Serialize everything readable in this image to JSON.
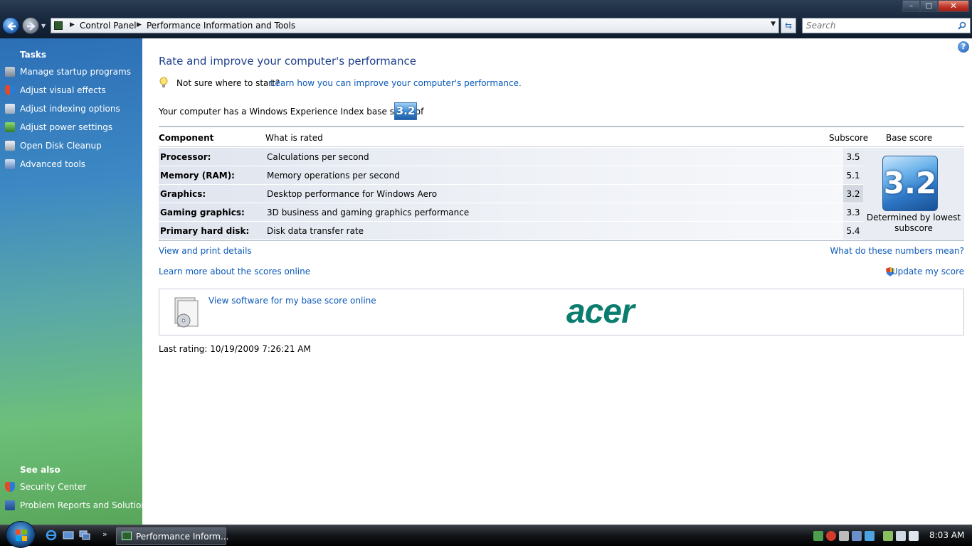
{
  "window": {
    "breadcrumbs": [
      "Control Panel",
      "Performance Information and Tools"
    ],
    "search_placeholder": "Search",
    "controls": {
      "minimize": "–",
      "maximize": "□",
      "close": "✕"
    }
  },
  "sidebar": {
    "tasks_heading": "Tasks",
    "tasks": [
      {
        "label": "Manage startup programs",
        "icon": "startup-programs-icon"
      },
      {
        "label": "Adjust visual effects",
        "icon": "shield-icon"
      },
      {
        "label": "Adjust indexing options",
        "icon": "indexing-icon"
      },
      {
        "label": "Adjust power settings",
        "icon": "power-icon"
      },
      {
        "label": "Open Disk Cleanup",
        "icon": "disk-cleanup-icon"
      },
      {
        "label": "Advanced tools",
        "icon": "advanced-tools-icon"
      }
    ],
    "see_also_heading": "See also",
    "see_also": [
      {
        "label": "Security Center",
        "icon": "security-center-icon"
      },
      {
        "label": "Problem Reports and Solutions",
        "icon": "problem-reports-icon"
      }
    ]
  },
  "main": {
    "title": "Rate and improve your computer's performance",
    "tip_prefix": "Not sure where to start?",
    "tip_link": "Learn how you can improve your computer's performance.",
    "base_score_sentence": "Your computer has a Windows Experience Index base score of",
    "base_score": "3.2",
    "table": {
      "headers": {
        "component": "Component",
        "what": "What is rated",
        "subscore": "Subscore",
        "base": "Base score"
      },
      "rows": [
        {
          "component": "Processor:",
          "what": "Calculations per second",
          "subscore": "3.5"
        },
        {
          "component": "Memory (RAM):",
          "what": "Memory operations per second",
          "subscore": "5.1"
        },
        {
          "component": "Graphics:",
          "what": "Desktop performance for Windows Aero",
          "subscore": "3.2"
        },
        {
          "component": "Gaming graphics:",
          "what": "3D business and gaming graphics performance",
          "subscore": "3.3"
        },
        {
          "component": "Primary hard disk:",
          "what": "Disk data transfer rate",
          "subscore": "5.4"
        }
      ],
      "base_caption": "Determined by lowest subscore"
    },
    "links": {
      "view_print": "View and print details",
      "what_mean": "What do these numbers mean?",
      "learn_online": "Learn more about the scores online",
      "update_score": "Update my score"
    },
    "oem": {
      "link": "View software for my base score online",
      "logo": "acer"
    },
    "last_rating": "Last rating: 10/19/2009 7:26:21 AM"
  },
  "taskbar": {
    "task_label": "Performance Inform...",
    "clock": "8:03 AM"
  },
  "colors": {
    "link": "#0a58b8",
    "title": "#1e3e8c",
    "acer": "#0b7d6e"
  }
}
